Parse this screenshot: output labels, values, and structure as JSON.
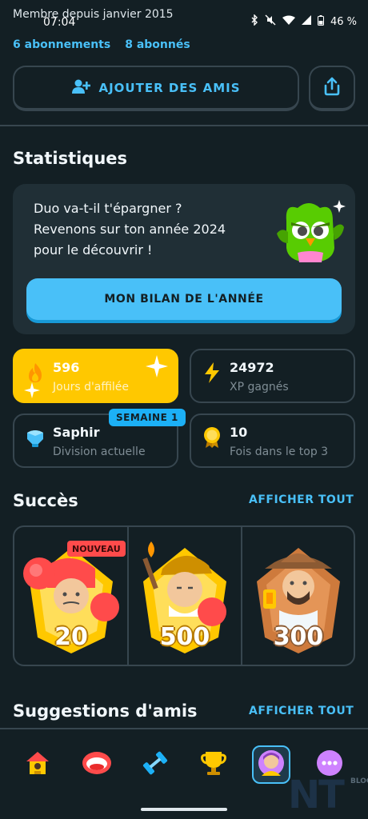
{
  "status_bar": {
    "time": "07:04",
    "battery": "46 %"
  },
  "profile": {
    "member_since": "Membre depuis janvier 2015",
    "subscriptions": "6 abonnements",
    "followers": "8 abonnés"
  },
  "actions": {
    "add_friends": "AJOUTER DES AMIS"
  },
  "stats_section": {
    "title": "Statistiques",
    "year_card": {
      "line1": "Duo va-t-il t'épargner ?",
      "line2": "Revenons sur ton année 2024",
      "line3": "pour le découvrir !",
      "button": "MON BILAN DE L'ANNÉE"
    },
    "tiles": {
      "streak": {
        "value": "596",
        "label": "Jours d'affilée"
      },
      "xp": {
        "value": "24972",
        "label": "XP gagnés"
      },
      "league": {
        "value": "Saphir",
        "label": "Division actuelle",
        "badge": "SEMAINE 1"
      },
      "top3": {
        "value": "10",
        "label": "Fois dans le top 3"
      }
    }
  },
  "achievements": {
    "title": "Succès",
    "view_all": "AFFICHER TOUT",
    "new_badge": "NOUVEAU",
    "items": [
      {
        "value": "20"
      },
      {
        "value": "500"
      },
      {
        "value": "300"
      }
    ]
  },
  "friend_suggestions": {
    "title": "Suggestions d'amis",
    "view_all": "AFFICHER TOUT"
  },
  "watermark": {
    "logo": "NT",
    "small": "BLOG"
  },
  "colors": {
    "background": "#131f24",
    "accent_blue": "#49c0f8",
    "streak_yellow": "#ffc800",
    "card_bg": "#202f36",
    "border": "#37464f"
  },
  "icons": [
    "add-friend-icon",
    "share-icon",
    "fire-icon",
    "lightning-icon",
    "diamond-icon",
    "medal-icon",
    "home-icon",
    "letters-icon",
    "dumbbell-icon",
    "trophy-icon",
    "profile-icon",
    "more-icon"
  ]
}
